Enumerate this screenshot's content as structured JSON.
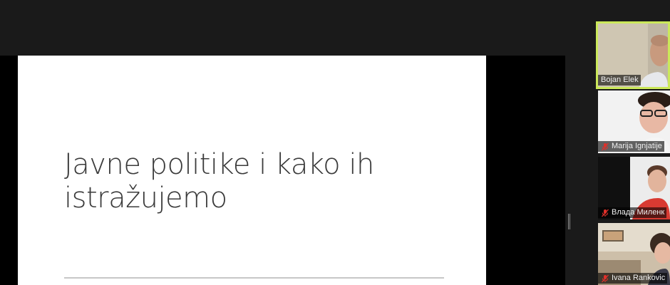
{
  "slide": {
    "title_line1": "Javne politike i kako ih",
    "title_line2": "istražujemo"
  },
  "participants": [
    {
      "name": "Bojan Elek",
      "muted": false,
      "active_speaker": true
    },
    {
      "name": "Marija Ignjatije",
      "muted": true,
      "active_speaker": false
    },
    {
      "name": "Влада Миленк",
      "muted": true,
      "active_speaker": false
    },
    {
      "name": "Ivana Rankovic",
      "muted": true,
      "active_speaker": false
    }
  ],
  "colors": {
    "active_speaker_border": "#cbe85a",
    "muted_icon": "#e0302a"
  },
  "icons": {
    "muted": "microphone-muted-icon"
  }
}
